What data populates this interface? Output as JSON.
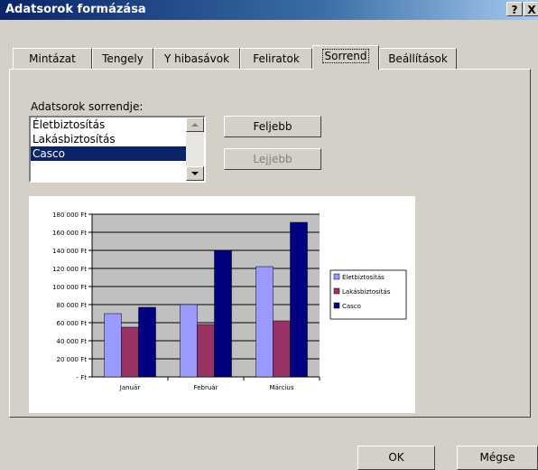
{
  "window": {
    "title": "Adatsorok formázása",
    "help": "?",
    "close": "X"
  },
  "tabs": [
    {
      "label": "Mintázat"
    },
    {
      "label": "Tengely"
    },
    {
      "label": "Y hibasávok"
    },
    {
      "label": "Feliratok"
    },
    {
      "label": "Sorrend"
    },
    {
      "label": "Beállítások"
    }
  ],
  "active_tab": "Sorrend",
  "order": {
    "label": "Adatsorok sorrendje:",
    "items": [
      "Életbiztosítás",
      "Lakásbiztosítás",
      "Casco"
    ],
    "selected": "Casco",
    "up_button": "Feljebb",
    "down_button": "Lejjebb"
  },
  "colors": {
    "life": "#9999ff",
    "home": "#993366",
    "casco": "#000080",
    "plot_bg": "#c0c0c0"
  },
  "chart_data": {
    "type": "bar",
    "categories": [
      "Január",
      "Február",
      "Március"
    ],
    "series": [
      {
        "name": "Életbiztosítás",
        "values": [
          70000,
          80000,
          122000
        ]
      },
      {
        "name": "Lakásbiztosítás",
        "values": [
          55000,
          58000,
          62000
        ]
      },
      {
        "name": "Casco",
        "values": [
          77000,
          140000,
          171000
        ]
      }
    ],
    "yticks": [
      "- Ft",
      "20 000 Ft",
      "40 000 Ft",
      "60 000 Ft",
      "80 000 Ft",
      "100 000 Ft",
      "120 000 Ft",
      "140 000 Ft",
      "160 000 Ft",
      "180 000 Ft"
    ],
    "ylim": [
      0,
      180000
    ],
    "grid": true,
    "legend_position": "right"
  },
  "footer": {
    "ok": "OK",
    "cancel": "Mégse"
  }
}
